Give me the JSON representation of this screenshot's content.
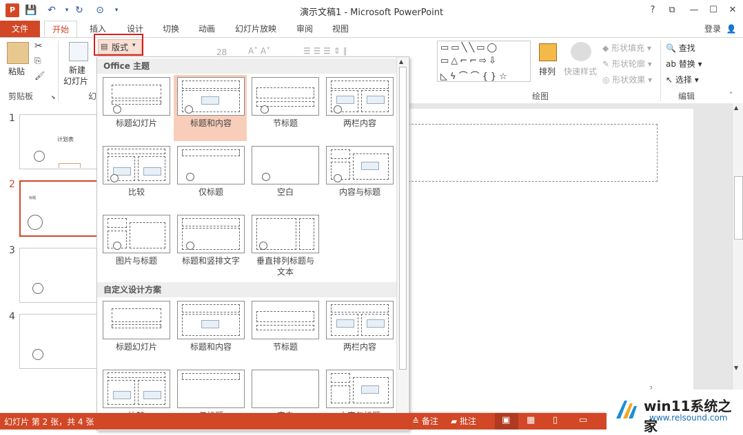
{
  "window": {
    "title": "演示文稿1 - Microsoft PowerPoint",
    "help": "?",
    "minimize": "—",
    "maximize": "☐",
    "close": "✕"
  },
  "app_icon_letter": "P",
  "tabs": [
    "文件",
    "开始",
    "插入",
    "设计",
    "切换",
    "动画",
    "幻灯片放映",
    "审阅",
    "视图"
  ],
  "login": "登录",
  "ribbon": {
    "paste": "粘贴",
    "clipboard": "剪贴板",
    "new_slide": "新建",
    "new_slide2": "幻灯片",
    "layout_btn": "版式",
    "font_size": "28",
    "drawing": "绘图",
    "arrange": "排列",
    "quick_styles": "快速样式",
    "shape_fill": "形状填充",
    "shape_outline": "形状轮廓",
    "shape_effects": "形状效果",
    "find": "查找",
    "replace": "替换",
    "select": "选择",
    "editing": "编辑"
  },
  "thumbnails": [
    {
      "num": "1",
      "title": "计划表"
    },
    {
      "num": "2",
      "title": "标题"
    },
    {
      "num": "3",
      "title": ""
    },
    {
      "num": "4",
      "title": ""
    }
  ],
  "dropdown": {
    "office_header": "Office 主题",
    "custom_header": "自定义设计方案",
    "office_layouts": [
      "标题幻灯片",
      "标题和内容",
      "节标题",
      "两栏内容",
      "比较",
      "仅标题",
      "空白",
      "内容与标题",
      "图片与标题",
      "标题和竖排文字",
      "垂直排列标题与\n文本"
    ],
    "custom_layouts": [
      "标题幻灯片",
      "标题和内容",
      "节标题",
      "两栏内容",
      "比较",
      "仅标题",
      "空白",
      "内容与标题"
    ]
  },
  "status": {
    "slide_info": "幻灯片 第 2 张，共 4 张",
    "notes": "备注",
    "comments": "批注",
    "page_num": "2"
  },
  "watermark": {
    "title": "win11系统之家",
    "url": "www.relsound.com"
  },
  "colors": {
    "accent": "#d24726",
    "selected": "#f8cdb9"
  }
}
